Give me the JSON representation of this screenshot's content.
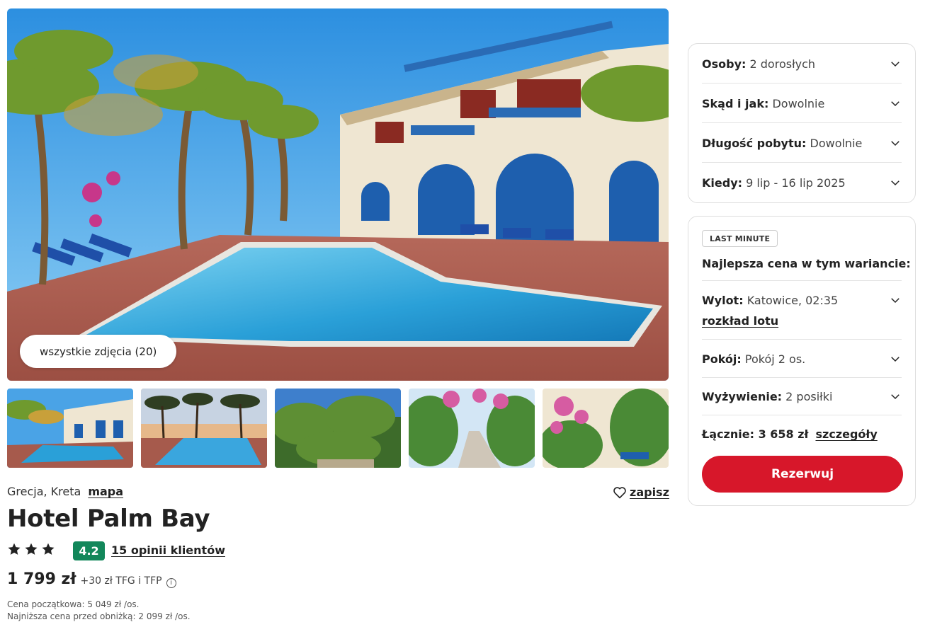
{
  "gallery": {
    "all_photos_label": "wszystkie zdjęcia (20)",
    "thumbnails": [
      "pool-view",
      "sea-sunset-pool",
      "garden-palms",
      "flower-walkway",
      "bougainvillea-garden"
    ]
  },
  "hotel": {
    "country_region": "Grecja, Kreta",
    "map_link": "mapa",
    "save_label": "zapisz",
    "name": "Hotel Palm Bay",
    "stars": 3,
    "rating": "4.2",
    "reviews_label": "15 opinii klientów",
    "price": "1 799 zł",
    "price_extra": "+30 zł TFG i TFP",
    "initial_price": "Cena początkowa: 5 049 zł /os.",
    "lowest_price": "Najniższa cena przed obniżką: 2 099 zł /os."
  },
  "filters": [
    {
      "key": "Osoby:",
      "value": "2 dorosłych"
    },
    {
      "key": "Skąd i jak:",
      "value": "Dowolnie"
    },
    {
      "key": "Długość pobytu:",
      "value": "Dowolnie"
    },
    {
      "key": "Kiedy:",
      "value": "9 lip - 16 lip 2025"
    }
  ],
  "offer": {
    "badge": "LAST MINUTE",
    "heading": "Najlepsza cena w tym wariancie:",
    "flight_key": "Wylot:",
    "flight_value": "Katowice, 02:35",
    "flight_schedule_link": "rozkład lotu",
    "room_key": "Pokój:",
    "room_value": "Pokój 2 os.",
    "board_key": "Wyżywienie:",
    "board_value": "2 posiłki",
    "total_label": "Łącznie: 3 658 zł",
    "details_link": "szczegóły",
    "book_button": "Rezerwuj"
  },
  "colors": {
    "accent_red": "#d7172a",
    "rating_green": "#12875a"
  },
  "icons": [
    "chevron-down-icon",
    "heart-icon",
    "star-icon",
    "info-icon"
  ]
}
